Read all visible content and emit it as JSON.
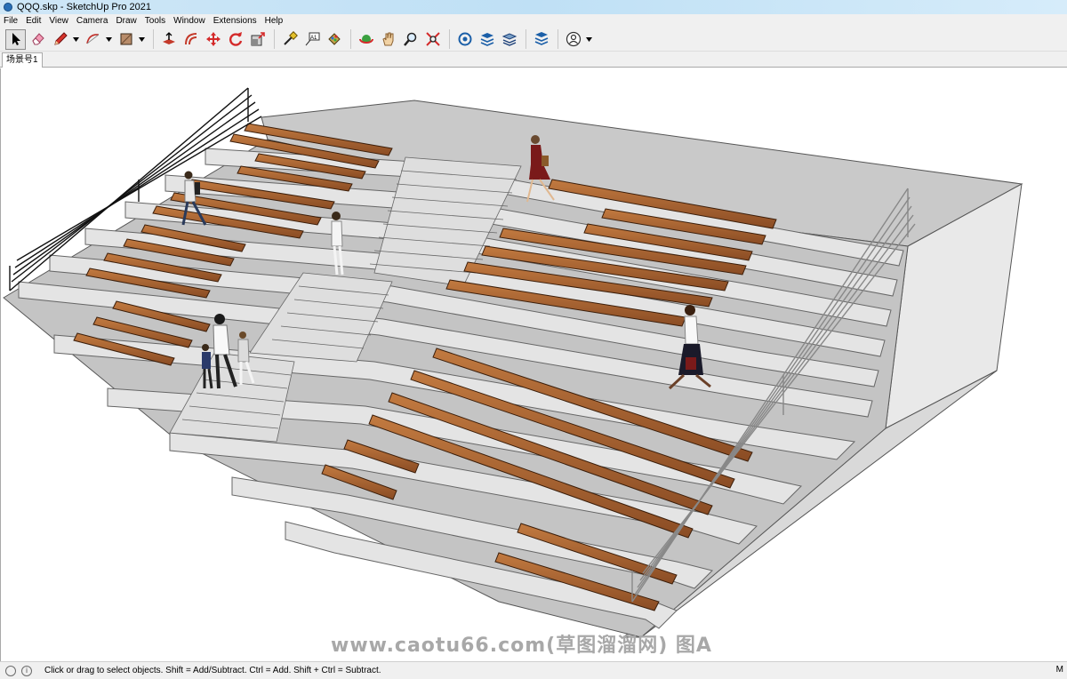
{
  "window": {
    "title": "QQQ.skp - SketchUp Pro 2021"
  },
  "menu": [
    "File",
    "Edit",
    "View",
    "Camera",
    "Draw",
    "Tools",
    "Window",
    "Extensions",
    "Help"
  ],
  "toolbar": {
    "tools": [
      {
        "name": "select-tool",
        "icon": "arrow-cursor-icon",
        "active": true
      },
      {
        "name": "eraser-tool",
        "icon": "eraser-icon"
      },
      {
        "name": "line-tool",
        "icon": "pencil-icon",
        "dropdown": true
      },
      {
        "name": "arc-tool",
        "icon": "arc-icon",
        "dropdown": true
      },
      {
        "name": "rectangle-tool",
        "icon": "rectangle-icon",
        "dropdown": true
      },
      {
        "name": "push-pull-tool",
        "icon": "push-pull-icon"
      },
      {
        "name": "offset-tool",
        "icon": "offset-icon"
      },
      {
        "name": "move-tool",
        "icon": "move-icon"
      },
      {
        "name": "rotate-tool",
        "icon": "rotate-icon"
      },
      {
        "name": "scale-tool",
        "icon": "scale-icon"
      },
      {
        "name": "tape-measure-tool",
        "icon": "tape-measure-icon"
      },
      {
        "name": "text-tool",
        "icon": "text-icon"
      },
      {
        "name": "paint-bucket-tool",
        "icon": "paint-bucket-icon"
      },
      {
        "name": "orbit-tool",
        "icon": "orbit-icon"
      },
      {
        "name": "pan-tool",
        "icon": "hand-icon"
      },
      {
        "name": "zoom-tool",
        "icon": "magnifier-icon"
      },
      {
        "name": "zoom-extents-tool",
        "icon": "zoom-extents-icon"
      },
      {
        "name": "warehouse-button",
        "icon": "warehouse-icon"
      },
      {
        "name": "extension-warehouse-button",
        "icon": "extension-warehouse-icon"
      },
      {
        "name": "layout-button",
        "icon": "layout-icon"
      },
      {
        "name": "extension-manager-button",
        "icon": "extension-manager-icon"
      },
      {
        "name": "account-button",
        "icon": "user-icon",
        "dropdown": true
      }
    ],
    "text_tool_label": "A1"
  },
  "scenes": [
    {
      "label": "场景号1"
    }
  ],
  "watermark": "www.caotu66.com(草图溜溜网) 图A",
  "status": {
    "hint": "Click or drag to select objects. Shift = Add/Subtract. Ctrl = Add. Shift + Ctrl = Subtract.",
    "right": "M",
    "info_icon": "i"
  },
  "colors": {
    "wood": "#9b5a2e",
    "wood_top": "#b8703a",
    "concrete_top": "#c6c6c6",
    "concrete_riser": "#e3e3e3",
    "concrete_side": "#b0b0b0"
  }
}
